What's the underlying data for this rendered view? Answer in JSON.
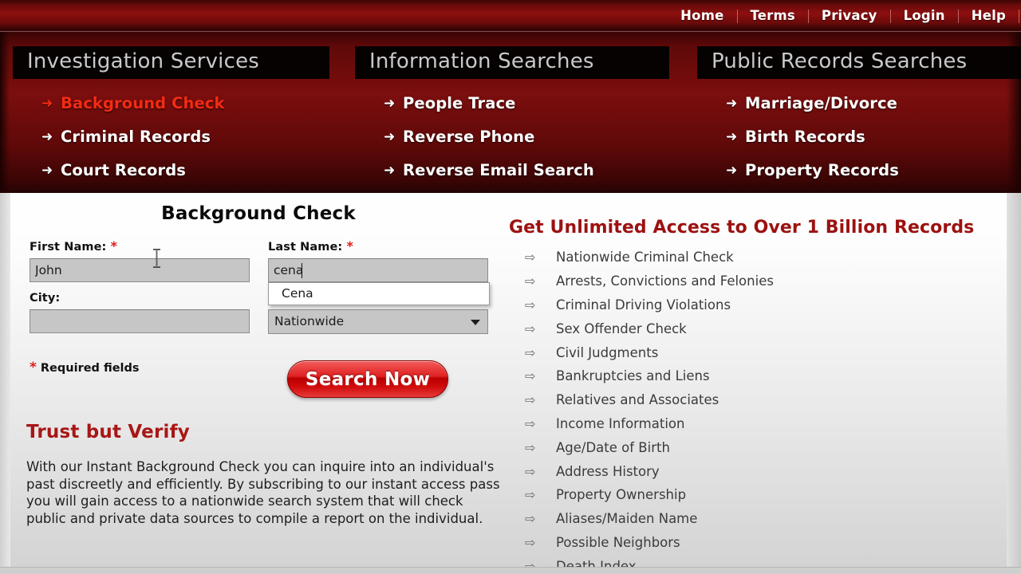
{
  "header": {
    "nav": [
      {
        "label": "Home"
      },
      {
        "label": "Terms"
      },
      {
        "label": "Privacy"
      },
      {
        "label": "Login"
      },
      {
        "label": "Help"
      }
    ]
  },
  "menu": {
    "columns": [
      {
        "heading": "Investigation Services",
        "items": [
          {
            "label": "Background Check",
            "arrow": "right-arrow-icon",
            "active": true
          },
          {
            "label": "Criminal Records",
            "arrow": "right-arrow-icon",
            "active": false
          },
          {
            "label": "Court Records",
            "arrow": "right-arrow-icon",
            "active": false
          }
        ]
      },
      {
        "heading": "Information Searches",
        "items": [
          {
            "label": "People Trace",
            "arrow": "right-arrow-icon",
            "active": false
          },
          {
            "label": "Reverse Phone",
            "arrow": "right-arrow-icon",
            "active": false
          },
          {
            "label": "Reverse Email Search",
            "arrow": "right-arrow-icon",
            "active": false
          }
        ]
      },
      {
        "heading": "Public Records Searches",
        "items": [
          {
            "label": "Marriage/Divorce",
            "arrow": "right-arrow-icon",
            "active": false
          },
          {
            "label": "Birth Records",
            "arrow": "right-arrow-icon",
            "active": false
          },
          {
            "label": "Property Records",
            "arrow": "right-arrow-icon",
            "active": false
          }
        ]
      }
    ],
    "arrow_glyph": "➜",
    "active_color": "#f42b13"
  },
  "form": {
    "title": "Background Check",
    "first_name": {
      "label": "First Name:",
      "required_mark": "*",
      "value": "John",
      "placeholder": ""
    },
    "last_name": {
      "label": "Last Name:",
      "required_mark": "*",
      "value": "cena",
      "placeholder": "",
      "autocomplete": {
        "visible": true,
        "options": [
          "Cena"
        ]
      }
    },
    "city": {
      "label": "City:",
      "value": "",
      "placeholder": ""
    },
    "state": {
      "selected": "Nationwide",
      "chevron": "chevron-down-icon"
    },
    "required_note": "Required fields",
    "required_star": "*",
    "search_button": "Search Now"
  },
  "trust": {
    "title": "Trust but Verify",
    "body": "With our Instant Background Check you can inquire into an individual's past discreetly and efficiently. By subscribing to our instant access pass you will gain access to a nationwide search system that will check public and private data sources to compile a report on the individual."
  },
  "benefits": {
    "title": "Get Unlimited Access to Over 1 Billion Records",
    "arrow_glyph": "⇨",
    "items": [
      {
        "label": "Nationwide Criminal Check"
      },
      {
        "label": "Arrests, Convictions and Felonies"
      },
      {
        "label": "Criminal Driving Violations"
      },
      {
        "label": "Sex Offender Check"
      },
      {
        "label": "Civil Judgments"
      },
      {
        "label": "Bankruptcies and Liens"
      },
      {
        "label": "Relatives and Associates"
      },
      {
        "label": "Income Information"
      },
      {
        "label": "Age/Date of Birth"
      },
      {
        "label": "Address History"
      },
      {
        "label": "Property Ownership"
      },
      {
        "label": "Aliases/Maiden Name"
      },
      {
        "label": "Possible Neighbors"
      },
      {
        "label": "Death Index"
      }
    ]
  },
  "colors": {
    "header_red": "#8c0f0f",
    "panel_red": "#7c0e0e",
    "active_link": "#f42b13",
    "trust_title": "#a81616",
    "benefits_title": "#9c1111",
    "required_star": "#e01b1b",
    "button_red": "#d01010",
    "input_gray": "#c6c6c6"
  }
}
